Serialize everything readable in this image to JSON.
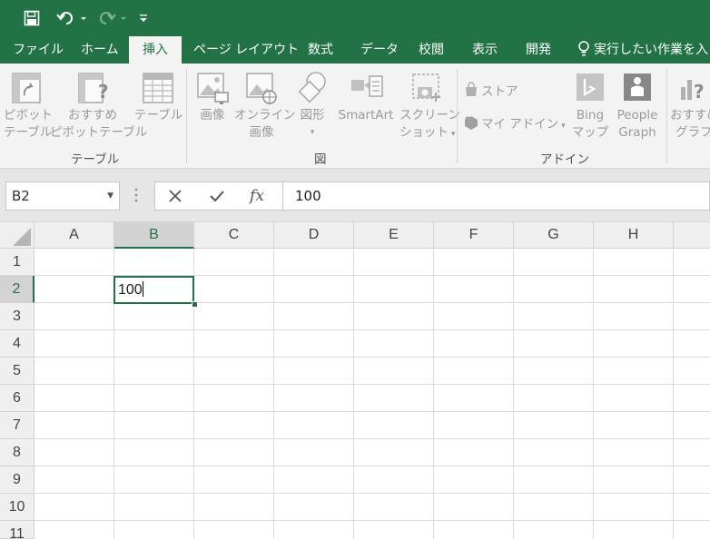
{
  "quick_access": {
    "save": "save-icon",
    "undo": "undo-icon",
    "redo": "redo-icon",
    "customize": "customize-icon"
  },
  "tabs": [
    {
      "label": "ファイル",
      "active": false
    },
    {
      "label": "ホーム",
      "active": false
    },
    {
      "label": "挿入",
      "active": true
    },
    {
      "label": "ページ レイアウト",
      "active": false
    },
    {
      "label": "数式",
      "active": false
    },
    {
      "label": "データ",
      "active": false
    },
    {
      "label": "校閲",
      "active": false
    },
    {
      "label": "表示",
      "active": false
    },
    {
      "label": "開発",
      "active": false
    }
  ],
  "tell_me": "実行したい作業を入",
  "ribbon": {
    "groups": {
      "table": "テーブル",
      "illustrations": "図",
      "addins": "アドイン"
    },
    "pivot": [
      "ピボット",
      "テーブル"
    ],
    "recommended_pivot": [
      "おすすめ",
      "ピボットテーブル"
    ],
    "table": "テーブル",
    "picture": "画像",
    "online_picture": [
      "オンライン",
      "画像"
    ],
    "shapes": "図形",
    "smartart": "SmartArt",
    "screenshot": [
      "スクリーン",
      "ショット"
    ],
    "store": "ストア",
    "my_addins": "マイ アドイン",
    "bing_maps": [
      "Bing",
      "マップ"
    ],
    "people_graph": [
      "People",
      "Graph"
    ],
    "recommended_chart": [
      "おすすめ",
      "グラフ"
    ]
  },
  "formula_bar": {
    "name_box": "B2",
    "value": "100",
    "fx": "fx"
  },
  "columns": [
    "A",
    "B",
    "C",
    "D",
    "E",
    "F",
    "G",
    "H"
  ],
  "rows": [
    "1",
    "2",
    "3",
    "4",
    "5",
    "6",
    "7",
    "8",
    "9",
    "10",
    "11"
  ],
  "selected": {
    "column": "B",
    "row": "2",
    "value": "100"
  },
  "colors": {
    "accent": "#217346"
  }
}
